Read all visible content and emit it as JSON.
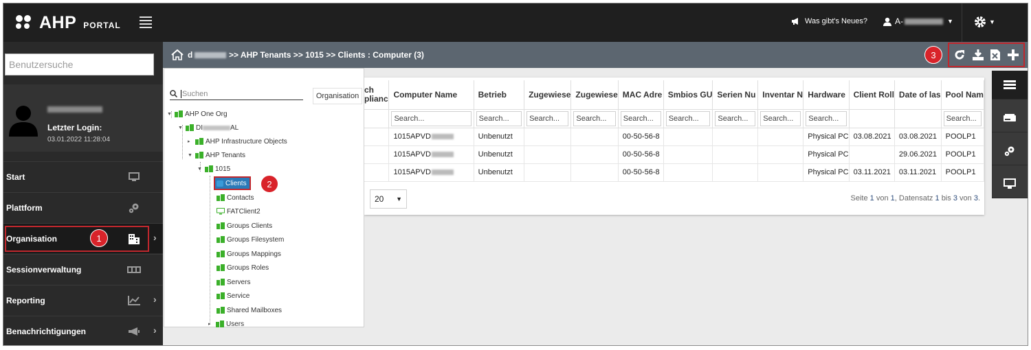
{
  "header": {
    "brand": "AHP",
    "portal": "PORTAL",
    "news_label": "Was gibt's Neues?",
    "user_prefix": "A-"
  },
  "sidebar": {
    "search_placeholder": "Benutzersuche",
    "profile": {
      "login_label": "Letzter Login:",
      "login_time": "03.01.2022 11:28:04"
    },
    "items": [
      {
        "label": "Start",
        "icon": "monitor-icon"
      },
      {
        "label": "Plattform",
        "icon": "gears-icon"
      },
      {
        "label": "Organisation",
        "icon": "building-icon",
        "active": true
      },
      {
        "label": "Sessionverwaltung",
        "icon": "sessions-icon"
      },
      {
        "label": "Reporting",
        "icon": "chart-icon"
      },
      {
        "label": "Benachrichtigungen",
        "icon": "megaphone-icon"
      }
    ]
  },
  "breadcrumb": {
    "prefix": "d",
    "path": ">> AHP Tenants >> 1015 >> Clients : Computer (3)"
  },
  "annotations": {
    "one": "1",
    "two": "2",
    "three": "3"
  },
  "tree": {
    "search_placeholder": "Suchen",
    "org_button": "Organisation",
    "nodes": {
      "root": "AHP One Org",
      "di_prefix": "DI",
      "di_suffix": "AL",
      "infra": "AHP Infrastructure Objects",
      "tenants": "AHP Tenants",
      "t1015": "1015",
      "clients": "Clients",
      "contacts": "Contacts",
      "fatclient": "FATClient2",
      "groups_clients": "Groups Clients",
      "groups_fs": "Groups Filesystem",
      "groups_mappings": "Groups Mappings",
      "groups_roles": "Groups Roles",
      "servers": "Servers",
      "service": "Service",
      "shared_mailboxes": "Shared Mailboxes",
      "users": "Users"
    }
  },
  "grid": {
    "columns": [
      "ch\nplianc",
      "Computer Name",
      "Betrieb",
      "Zugewiese",
      "Zugewiese",
      "MAC Adre",
      "Smbios GU",
      "Serien Nu",
      "Inventar N",
      "Hardware",
      "Client Roll",
      "Date of las",
      "Pool Nam"
    ],
    "filter_placeholder": "Search...",
    "rows": [
      {
        "status_color": "#8a8a8a",
        "name": "1015APVD",
        "betrieb": "Unbenutzt",
        "mac": "00-50-56-8",
        "hardware": "Physical PC",
        "client_roll": "03.08.2021",
        "date_last": "03.08.2021",
        "pool": "POOLP1"
      },
      {
        "status_color": "#8a8a8a",
        "name": "1015APVD",
        "betrieb": "Unbenutzt",
        "mac": "00-50-56-8",
        "hardware": "Physical PC",
        "client_roll": "",
        "date_last": "29.06.2021",
        "pool": "POOLP1"
      },
      {
        "status_color": "#36c236",
        "name": "1015APVD",
        "betrieb": "Unbenutzt",
        "mac": "00-50-56-8",
        "hardware": "Physical PC",
        "client_roll": "03.11.2021",
        "date_last": "03.11.2021",
        "pool": "POOLP1"
      }
    ],
    "page_size": "20",
    "paging": {
      "p1": "Seite",
      "page": "1",
      "p2": "von",
      "pages": "1",
      "p3": ", Datensatz",
      "from": "1",
      "p4": "bis",
      "to": "3",
      "p5": "von",
      "total": "3",
      "p6": "."
    }
  }
}
